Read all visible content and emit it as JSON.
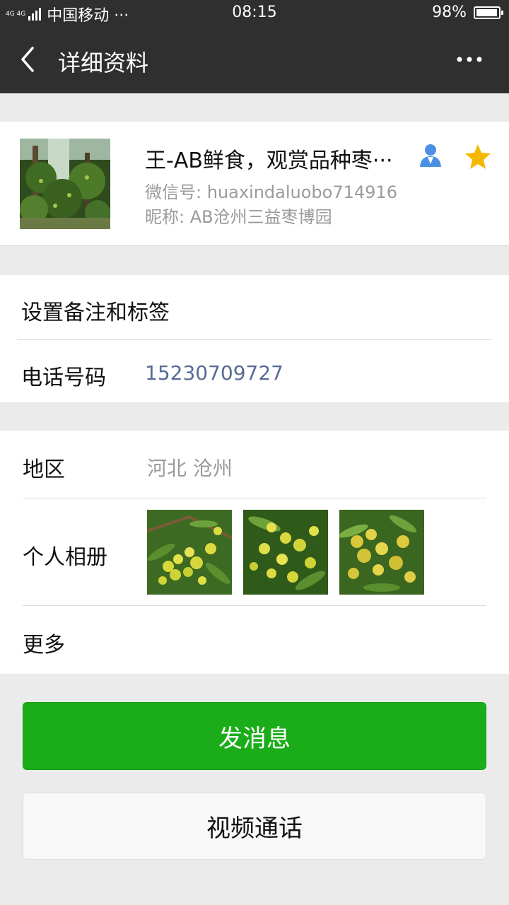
{
  "status_bar": {
    "network": "4G 4G",
    "carrier": "中国移动 ···",
    "time": "08:15",
    "battery": "98%",
    "battery_level": 0.98
  },
  "nav": {
    "title": "详细资料",
    "back_icon": "back-arrow-icon",
    "more_icon": "more-dots-icon"
  },
  "profile": {
    "name": "王-AB鲜食，观赏品种枣···",
    "wechat_id": "微信号: huaxindaluobo714916",
    "nickname": "昵称: AB沧州三益枣博园",
    "icons": [
      "person-icon",
      "star-icon"
    ],
    "star_color": "#f5b800",
    "person_color": "#4a90e2"
  },
  "group1": {
    "remark_label": "设置备注和标签",
    "phone_label": "电话号码",
    "phone_value": "15230709727"
  },
  "group2": {
    "region_label": "地区",
    "region_value": "河北  沧州",
    "album_label": "个人相册",
    "more_label": "更多"
  },
  "buttons": {
    "send_message": "发消息",
    "video_call": "视频通话"
  },
  "colors": {
    "nav_bg": "#2f2f2f",
    "primary_green": "#1aad19",
    "link_blue": "#576b95"
  }
}
